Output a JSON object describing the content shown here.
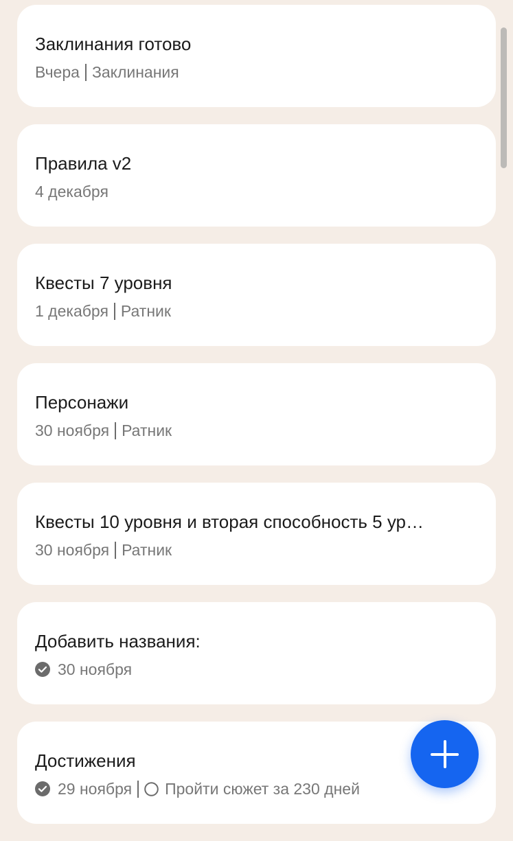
{
  "notes": [
    {
      "title": "Заклинания готово",
      "date": "Вчера",
      "folder": "Заклинания"
    },
    {
      "title": "Правила v2",
      "date": "4 декабря"
    },
    {
      "title": "Квесты 7 уровня",
      "date": "1 декабря",
      "folder": "Ратник"
    },
    {
      "title": "Персонажи",
      "date": "30 ноября",
      "folder": "Ратник"
    },
    {
      "title": "Квесты 10 уровня и вторая способность 5 ур…",
      "date": "30 ноября",
      "folder": "Ратник"
    },
    {
      "title": "Добавить названия:",
      "date": "30 ноября",
      "checked": true
    },
    {
      "title": "Достижения",
      "date": "29 ноября",
      "checked": true,
      "task": "Пройти сюжет за 230 дней"
    }
  ],
  "colors": {
    "background": "#f5ede6",
    "card": "#ffffff",
    "accent": "#1565f0"
  },
  "fab_icon": "plus-icon"
}
